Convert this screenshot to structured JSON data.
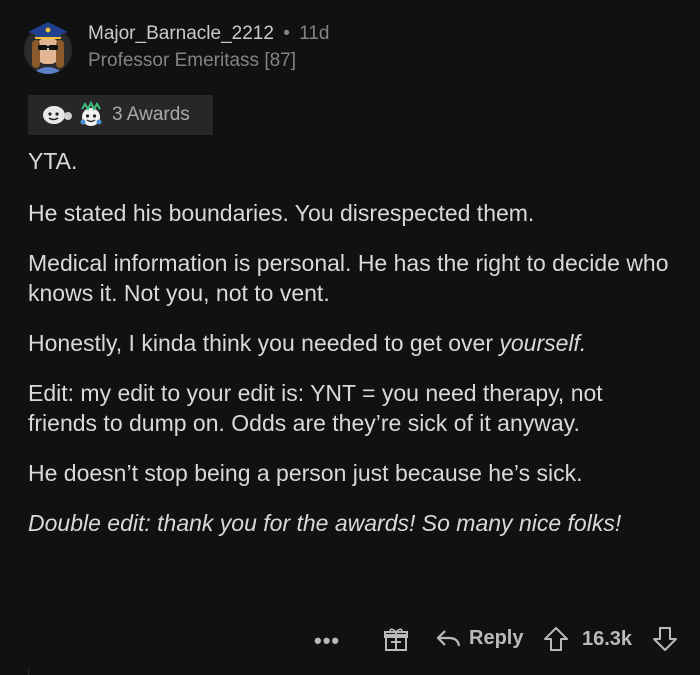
{
  "comment": {
    "author": "Major_Barnacle_2212",
    "separator": "•",
    "age": "11d",
    "flair": "Professor Emeritass [87]",
    "awards": {
      "count_label": "3 Awards",
      "icons": [
        "wholesome-award-icon",
        "animal-award-icon"
      ]
    },
    "paragraphs": [
      "YTA.",
      "He stated his boundaries. You disrespected them.",
      "Medical information is personal. He has the right to decide who knows it. Not you, not to vent.",
      "Honestly, I kinda think you needed to get over ",
      "Edit: my edit to your edit is: YNT = you need therapy, not friends to dump on. Odds are they’re sick of it anyway.",
      "He doesn’t stop being a person just because he’s sick.",
      "Double edit: thank you for the awards! So many nice folks!"
    ],
    "emphasis_word": "yourself.",
    "actions": {
      "more": "•••",
      "reply_label": "Reply",
      "score": "16.3k"
    }
  },
  "colors": {
    "background": "#111111",
    "text": "#d7dadc",
    "muted": "#818384",
    "award_chip": "#272729"
  }
}
